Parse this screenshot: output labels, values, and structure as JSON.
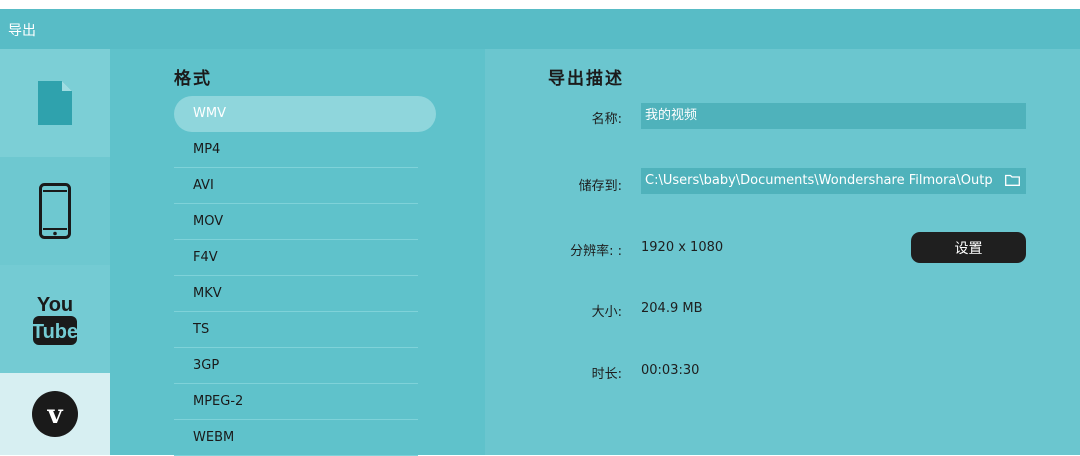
{
  "window": {
    "title": "导出"
  },
  "sidebar": {
    "tabs": [
      {
        "id": "local",
        "icon": "file-icon",
        "active": true
      },
      {
        "id": "device",
        "icon": "phone-icon",
        "active": false
      },
      {
        "id": "youtube",
        "icon": "youtube-icon",
        "active": false
      },
      {
        "id": "vimeo",
        "icon": "vimeo-icon",
        "active": false
      }
    ]
  },
  "formats": {
    "title": "格式",
    "items": [
      "WMV",
      "MP4",
      "AVI",
      "MOV",
      "F4V",
      "MKV",
      "TS",
      "3GP",
      "MPEG-2",
      "WEBM"
    ],
    "selected": "WMV"
  },
  "details": {
    "title": "导出描述",
    "name_label": "名称:",
    "name_value": "我的视频",
    "save_label": "储存到:",
    "save_value": "C:\\Users\\baby\\Documents\\Wondershare Filmora\\Outp",
    "resolution_label": "分辨率: :",
    "resolution_value": "1920 x 1080",
    "settings_label": "设置",
    "size_label": "大小:",
    "size_value": "204.9 MB",
    "duration_label": "时长:",
    "duration_value": "00:03:30"
  },
  "colors": {
    "titlebar": "#58bcc6",
    "sidebar": "#75cbd3",
    "format_panel": "#5fc2cb",
    "detail_panel": "#6bc6cf",
    "input_bg": "#4fb2bb",
    "button_bg": "#1f1f1f"
  }
}
